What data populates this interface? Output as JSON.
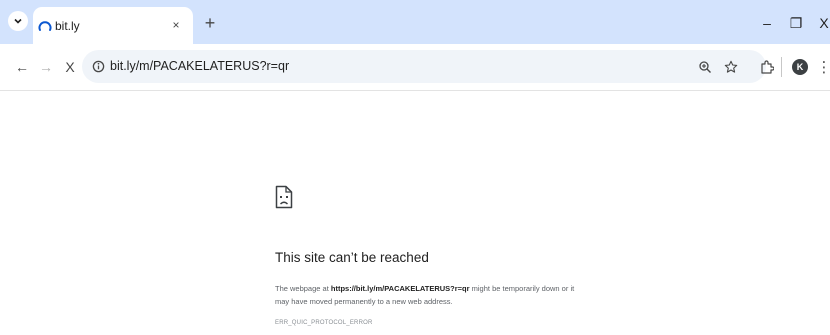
{
  "tab": {
    "title": "bit.ly",
    "close_label": "×",
    "new_tab_label": "+"
  },
  "window_controls": {
    "minimize": "–",
    "restore": "❐",
    "close": "X"
  },
  "toolbar": {
    "back": "←",
    "forward": "→",
    "stop": "X",
    "url": "bit.ly/m/PACAKELATERUS?r=qr",
    "avatar_letter": "K",
    "menu": "⋮"
  },
  "error_page": {
    "title": "This site can’t be reached",
    "body_prefix": "The webpage at ",
    "body_url": "https://bit.ly/m/PACAKELATERUS?r=qr",
    "body_suffix": " might be temporarily down or it may have moved permanently to a new web address.",
    "error_code": "ERR_QUIC_PROTOCOL_ERROR"
  },
  "colors": {
    "tab_strip": "#d3e3fd",
    "omnibox": "#f0f4f9",
    "text_primary": "#1f1f1f",
    "text_secondary": "#5f6368"
  }
}
